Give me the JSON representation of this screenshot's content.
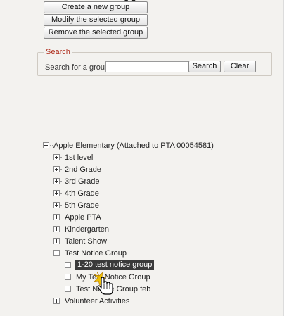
{
  "page_heading_fragment": "g",
  "actions": {
    "create": "Create a new group",
    "modify": "Modify the selected group",
    "remove": "Remove the selected group"
  },
  "search": {
    "legend": "Search",
    "label": "Search for a group:",
    "value": "",
    "search_button": "Search",
    "clear_button": "Clear"
  },
  "tree": {
    "root": "Apple Elementary (Attached to PTA 00054581)",
    "children": [
      "1st level",
      "2nd Grade",
      "3rd Grade",
      "4th Grade",
      "5th Grade",
      "Apple PTA",
      "Kindergarten",
      "Talent Show",
      "Test Notice Group",
      "Volunteer Activities"
    ],
    "test_notice_children": [
      "1-20 test notice group",
      "My Test Notice Group",
      "Test Notice Group feb"
    ]
  },
  "colors": {
    "legend": "#b03020",
    "selection": "#3a3a3a",
    "click_burst": "#f0c000"
  },
  "icons": {
    "cursor": "hand-pointer-icon"
  }
}
